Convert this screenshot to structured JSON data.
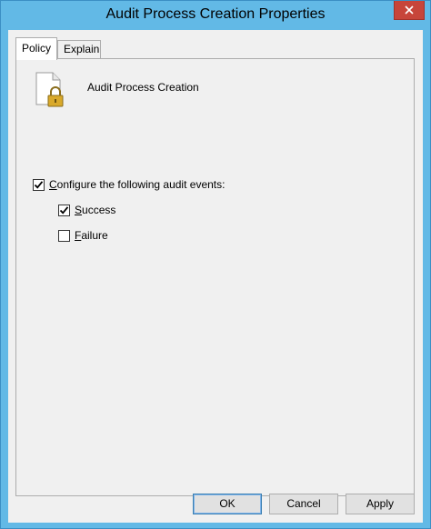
{
  "window": {
    "title": "Audit Process Creation Properties"
  },
  "tabs": [
    {
      "label": "Policy",
      "active": true
    },
    {
      "label": "Explain",
      "active": false
    }
  ],
  "policy": {
    "name": "Audit Process Creation",
    "icon": "document-lock-icon"
  },
  "options": {
    "configure": {
      "label_accel": "C",
      "label_rest": "onfigure the following audit events:",
      "checked": true
    },
    "success": {
      "label_accel": "S",
      "label_rest": "uccess",
      "checked": true
    },
    "failure": {
      "label_accel": "F",
      "label_rest": "ailure",
      "checked": false
    }
  },
  "buttons": {
    "ok": "OK",
    "cancel": "Cancel",
    "apply": "Apply"
  },
  "colors": {
    "frame": "#62b9e6",
    "close": "#c7453a",
    "client": "#f0f0f0"
  }
}
